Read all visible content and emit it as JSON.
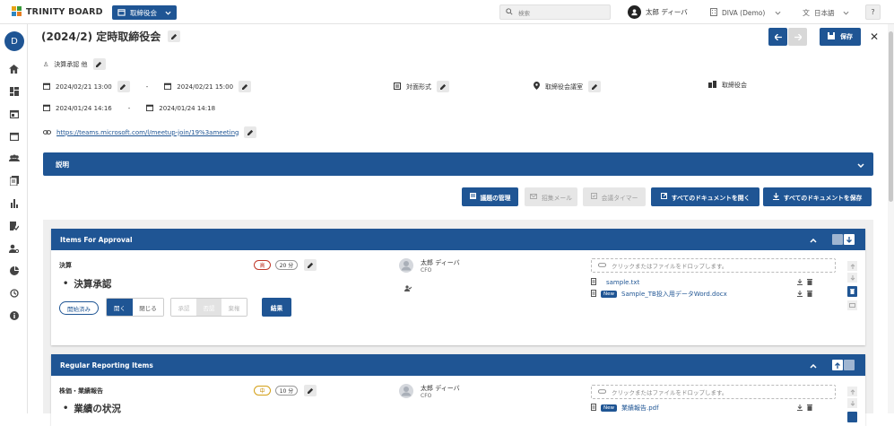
{
  "app": {
    "logo_text": "TRINITY BOARD"
  },
  "header": {
    "meeting_selector": "取締役会",
    "search_placeholder": "検索",
    "user_name": "太郎 ディーバ",
    "company": "DIVA (Demo)",
    "language": "日本語",
    "help": "?"
  },
  "sidebar": {
    "user_initial": "D"
  },
  "meeting": {
    "title": "(2024/2) 定時取締役会",
    "agenda_summary": "決算承認 他",
    "start": "2024/02/21 13:00",
    "end": "2024/02/21 15:00",
    "range_sep": "-",
    "format": "対面形式",
    "location": "取締役会議室",
    "body": "取締役会",
    "created": "2024/01/24 14:16",
    "updated": "2024/01/24 14:18",
    "url": "https://teams.microsoft.com/l/meetup-join/19%3ameeting",
    "save_label": "保存"
  },
  "description": {
    "label": "説明"
  },
  "actions": {
    "manage_agenda": "議題の管理",
    "invite_mail": "招集メール",
    "timer": "会議タイマー",
    "open_all": "すべてのドキュメントを開く",
    "save_all": "すべてのドキュメントを保存"
  },
  "sections": [
    {
      "header": "Items For Approval",
      "item": {
        "category": "決算",
        "title": "決算承認",
        "priority": "高",
        "duration": "20 分",
        "presenter": "太郎 ディーバ",
        "presenter_role": "CFO",
        "drop_text": "クリックまたはファイルをドロップします。",
        "files": [
          {
            "name": "sample.txt",
            "new": false
          },
          {
            "name": "Sample_TB投入用データWord.docx",
            "new": true
          }
        ],
        "status": "開始済み",
        "open": "開く",
        "close": "閉じる",
        "approve": "承認",
        "reject": "否認",
        "abstain": "棄権",
        "result": "結果",
        "new_badge": "New"
      }
    },
    {
      "header": "Regular Reporting Items",
      "item": {
        "category": "株価・業績報告",
        "title": "業績の状況",
        "priority": "中",
        "duration": "10 分",
        "presenter": "太郎 ディーバ",
        "presenter_role": "CFO",
        "drop_text": "クリックまたはファイルをドロップします。",
        "files": [
          {
            "name": "業績報告.pdf",
            "new": true
          }
        ],
        "new_badge": "New"
      }
    }
  ],
  "colors": {
    "primary": "#1f5594",
    "priority_high": "#c0392b",
    "priority_mid": "#d4a017"
  }
}
